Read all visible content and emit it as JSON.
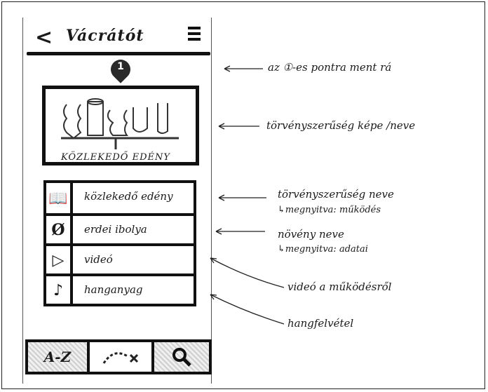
{
  "header": {
    "back_icon": "<",
    "title": "Vácrátót",
    "menu_icon": "hamburger-icon"
  },
  "pin": {
    "number": "1"
  },
  "image_box": {
    "caption": "KÖZLEKEDŐ EDÉNY"
  },
  "list": {
    "items": [
      {
        "icon": "book-icon",
        "icon_glyph": "📖",
        "label": "közlekedő edény"
      },
      {
        "icon": "empty-set-icon",
        "icon_glyph": "Ø",
        "label": "erdei ibolya"
      },
      {
        "icon": "play-icon",
        "icon_glyph": "▷",
        "label": "videó"
      },
      {
        "icon": "music-note-icon",
        "icon_glyph": "♪",
        "label": "hanganyag"
      }
    ]
  },
  "bottom_bar": {
    "tab_az": "A-Z",
    "tab_route": "route-icon",
    "tab_search": "search-icon"
  },
  "annotations": {
    "pin": "az ①-es pontra ment rá",
    "image": "törvényszerűség képe /neve",
    "name": "törvényszerűség neve",
    "name_sub": "↳megnyitva: működés",
    "plant": "növény neve",
    "plant_sub": "↳megnyitva: adatai",
    "video": "videó a működésről",
    "audio": "hangfelvétel"
  }
}
